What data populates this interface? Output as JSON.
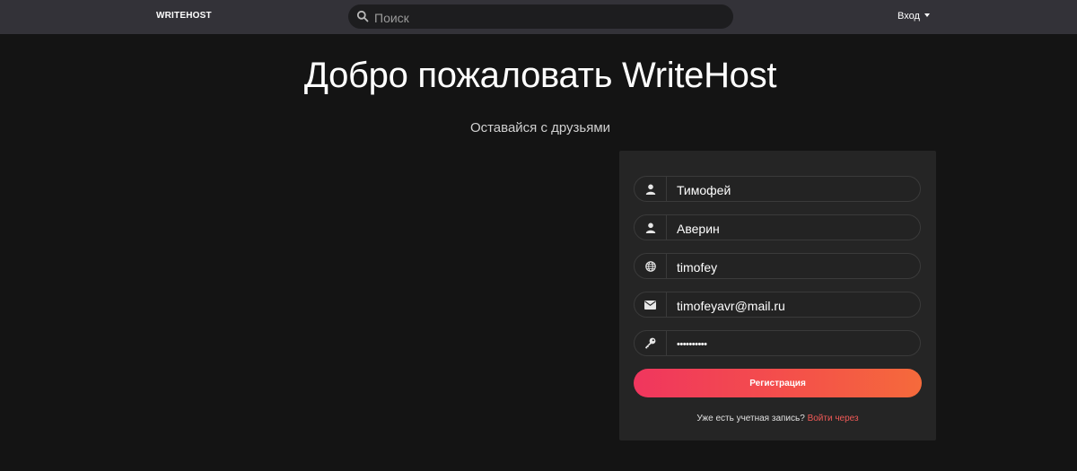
{
  "navbar": {
    "brand": "WRITEHOST",
    "search_placeholder": "Поиск",
    "login_label": "Вход"
  },
  "hero": {
    "title": "Добро пожаловать WriteHost",
    "subtitle": "Оставайся с друзьями"
  },
  "form": {
    "fields": [
      {
        "icon": "user-icon",
        "value": "Тимофей"
      },
      {
        "icon": "user-icon",
        "value": "Аверин"
      },
      {
        "icon": "globe-icon",
        "value": "timofey"
      },
      {
        "icon": "envelope-icon",
        "value": "timofeyavr@mail.ru"
      },
      {
        "icon": "key-icon",
        "value": "••••••••••"
      }
    ],
    "submit_label": "Регистрация",
    "footer_text": "Уже есть учетная запись?",
    "footer_link": "Войти через"
  },
  "colors": {
    "navbar_bg": "#333238",
    "page_bg": "#141414",
    "card_bg": "#252525",
    "button_gradient_start": "#f0365e",
    "button_gradient_end": "#f56a3b",
    "link": "#f25a57"
  }
}
